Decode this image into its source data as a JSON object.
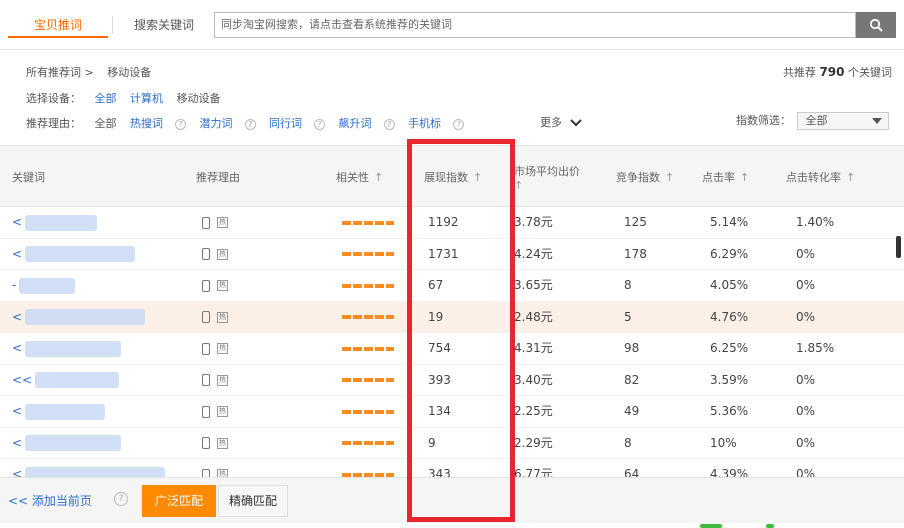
{
  "tabs": [
    {
      "label": "宝贝推词",
      "active": true
    },
    {
      "label": "搜索关键词",
      "active": false
    }
  ],
  "search": {
    "placeholder": "同步淘宝网搜索，请点击查看系统推荐的关键词"
  },
  "filters": {
    "breadcrumb": {
      "root": "所有推荐词 >",
      "current": "移动设备"
    },
    "total": {
      "prefix": "共推荐",
      "count": "790",
      "suffix": "个关键词"
    },
    "device": {
      "label": "选择设备：",
      "options": [
        "全部",
        "计算机",
        "移动设备"
      ]
    },
    "reason": {
      "label": "推荐理由：",
      "options": [
        "全部",
        "热搜词",
        "潜力词",
        "同行词",
        "飙升词",
        "手机标"
      ]
    },
    "more_label": "更多",
    "index_filter": {
      "label": "指数筛选：",
      "value": "全部"
    }
  },
  "table": {
    "headers": [
      "关键词",
      "推荐理由",
      "相关性",
      "展现指数",
      "市场平均出价",
      "竞争指数",
      "点击率",
      "点击转化率"
    ],
    "rows": [
      {
        "keyword": "<",
        "impression": "1192",
        "bid": "3.78元",
        "competition": "125",
        "ctr": "5.14%",
        "cvr": "1.40%"
      },
      {
        "keyword": "<",
        "impression": "1731",
        "bid": "4.24元",
        "competition": "178",
        "ctr": "6.29%",
        "cvr": "0%"
      },
      {
        "keyword": "-",
        "impression": "67",
        "bid": "3.65元",
        "competition": "8",
        "ctr": "4.05%",
        "cvr": "0%"
      },
      {
        "keyword": "<",
        "impression": "19",
        "bid": "2.48元",
        "competition": "5",
        "ctr": "4.76%",
        "cvr": "0%"
      },
      {
        "keyword": "<",
        "impression": "754",
        "bid": "4.31元",
        "competition": "98",
        "ctr": "6.25%",
        "cvr": "1.85%"
      },
      {
        "keyword": "<<",
        "impression": "393",
        "bid": "3.40元",
        "competition": "82",
        "ctr": "3.59%",
        "cvr": "0%"
      },
      {
        "keyword": "<",
        "impression": "134",
        "bid": "2.25元",
        "competition": "49",
        "ctr": "5.36%",
        "cvr": "0%"
      },
      {
        "keyword": "<",
        "impression": "9",
        "bid": "2.29元",
        "competition": "8",
        "ctr": "10%",
        "cvr": "0%"
      },
      {
        "keyword": "<",
        "impression": "343",
        "bid": "6.77元",
        "competition": "64",
        "ctr": "4.39%",
        "cvr": "0%"
      }
    ],
    "highlighted_row": 3,
    "hot_icon_text": "热"
  },
  "bottom": {
    "add_page_label": "<< 添加当前页",
    "broad_match_label": "广泛匹配",
    "exact_match_label": "精确匹配"
  },
  "colors": {
    "accent": "#ff6a00",
    "link": "#2b6dcf",
    "highlight_box": "#e8262d"
  },
  "icons": {
    "search": "search-icon",
    "sort": "sort-arrow-icon",
    "device": "phone-icon",
    "help": "question-icon"
  }
}
